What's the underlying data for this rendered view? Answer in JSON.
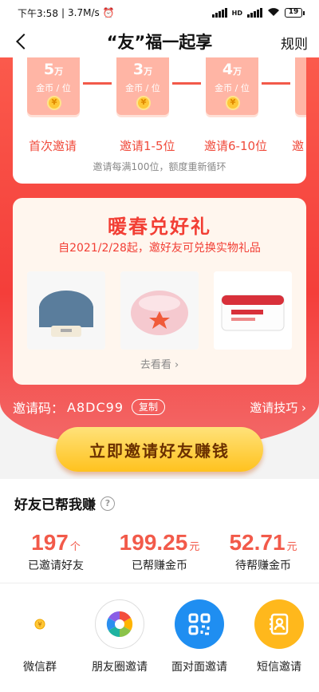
{
  "status_bar": {
    "time": "下午3:58",
    "speed": "3.7M/s",
    "network": "HD",
    "battery": "19"
  },
  "nav": {
    "title": "“友”福一起享",
    "rules": "规则"
  },
  "tiers": [
    {
      "amount": "5",
      "unit_small": "万",
      "per": "金币 / 位",
      "label": "首次邀请"
    },
    {
      "amount": "3",
      "unit_small": "万",
      "per": "金币 / 位",
      "label": "邀请1-5位"
    },
    {
      "amount": "4",
      "unit_small": "万",
      "per": "金币 / 位",
      "label": "邀请6-10位"
    },
    {
      "amount": "",
      "unit_small": "",
      "per": "",
      "label": "邀"
    }
  ],
  "tier_note": "邀请每满100位，额度重新循环",
  "promo": {
    "title": "暖春兑好礼",
    "subtitle": "自2021/2/28起，邀好友可兑换实物礼品",
    "products": [
      "speaker",
      "scarf",
      "wipes"
    ],
    "see_more": "去看看 ›"
  },
  "invite": {
    "label": "邀请码：",
    "code": "A8DC99",
    "copy": "复制",
    "tips": "邀请技巧 ›"
  },
  "main_button": "立即邀请好友赚钱",
  "earned": {
    "title": "好友已帮我赚",
    "stats": [
      {
        "value": "197",
        "unit": "个",
        "label": "已邀请好友"
      },
      {
        "value": "199.25",
        "unit": "元",
        "label": "已帮赚金币"
      },
      {
        "value": "52.71",
        "unit": "元",
        "label": "待帮赚金币"
      }
    ]
  },
  "share": [
    {
      "label": "微信群",
      "icon": "coin-icon"
    },
    {
      "label": "朋友圈邀请",
      "icon": "camera-aperture-icon"
    },
    {
      "label": "面对面邀请",
      "icon": "qr-code-icon"
    },
    {
      "label": "短信邀请",
      "icon": "contact-card-icon"
    }
  ],
  "colors": {
    "accent_red": "#f43e3a",
    "button_yellow": "#ffc21e",
    "stat_red": "#f25a4a"
  }
}
